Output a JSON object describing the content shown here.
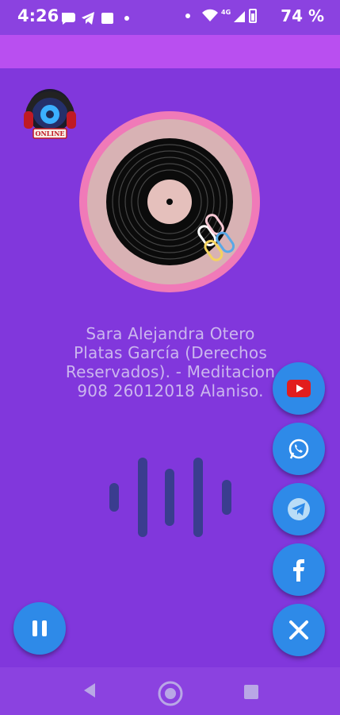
{
  "status_bar": {
    "time": "4:26",
    "battery": "74 %",
    "signal_label": "4G"
  },
  "player": {
    "logo_text": "ONLINE",
    "track_title": "Sara Alejandra Otero\nPlatas García (Derechos\nReservados). - Meditacion\n908 26012018 Alaniso."
  },
  "social": {
    "items": [
      "youtube",
      "whatsapp",
      "telegram",
      "facebook",
      "close"
    ]
  },
  "colors": {
    "background": "#8137dc",
    "fab": "#2e8ae8",
    "disc_ring": "#f07ab8"
  },
  "icons": {
    "pause": "pause-icon",
    "youtube": "youtube-icon",
    "whatsapp": "whatsapp-icon",
    "telegram": "telegram-icon",
    "facebook": "facebook-icon",
    "close": "close-icon"
  }
}
